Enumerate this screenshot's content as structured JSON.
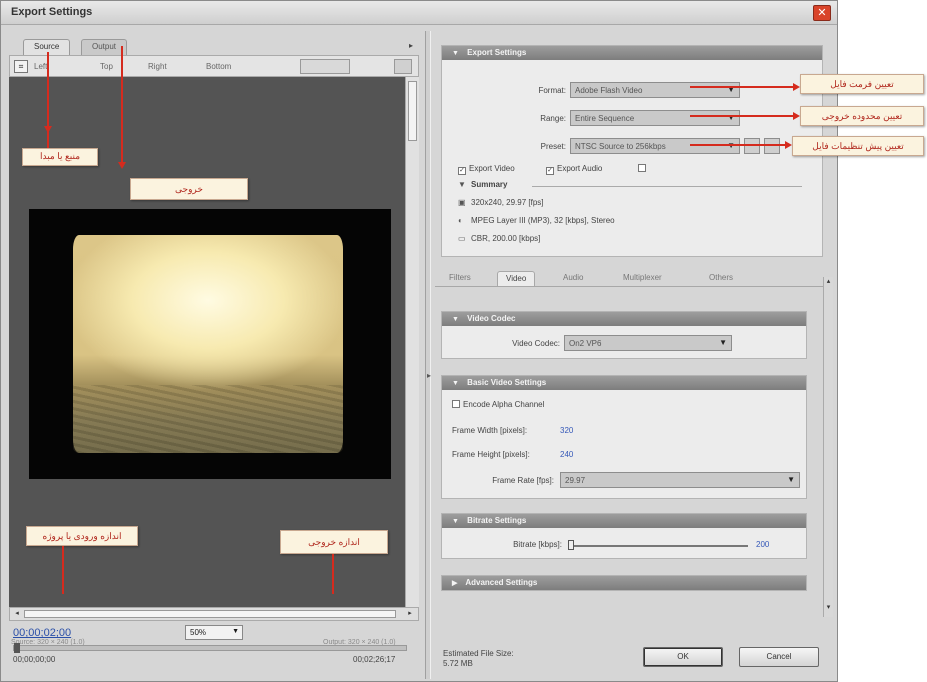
{
  "window": {
    "title": "Export Settings",
    "close_glyph": "✕"
  },
  "left": {
    "tabs": [
      {
        "label": "Source"
      },
      {
        "label": "Output"
      }
    ],
    "crop": {
      "left": "Left",
      "top": "Top",
      "right": "Right",
      "bottom": "Bottom"
    },
    "source_size": "Source: 320 × 240 (1.0)",
    "output_size": "Output: 320 × 240 (1.0)",
    "timecode": "00;00;02;00",
    "zoom": "50%",
    "time_start": "00;00;00;00",
    "time_end": "00;02;26;17"
  },
  "annotations": {
    "source": "منبع یا مبدا",
    "output": "خروجی",
    "project_input_size": "اندازه ورودی یا پروژه",
    "output_size": "اندازه خروجی",
    "file_format": "تعیین فرمت فایل",
    "output_range": "تعیین محدوده خروجی",
    "preset": "تعیین پیش تنظیمات فایل"
  },
  "export_settings": {
    "header": "Export Settings",
    "format_label": "Format:",
    "format_value": "Adobe Flash Video",
    "range_label": "Range:",
    "range_value": "Entire Sequence",
    "preset_label": "Preset:",
    "preset_value": "NTSC Source to 256kbps",
    "export_video": "Export Video",
    "export_audio": "Export Audio",
    "summary_label": "Summary",
    "summary": [
      "320x240, 29.97 [fps]",
      "MPEG Layer III (MP3), 32 [kbps], Stereo",
      "CBR, 200.00 [kbps]"
    ]
  },
  "tabs2": [
    {
      "label": "Filters"
    },
    {
      "label": "Video"
    },
    {
      "label": "Audio"
    },
    {
      "label": "Multiplexer"
    },
    {
      "label": "Others"
    }
  ],
  "video_codec": {
    "header": "Video Codec",
    "label": "Video Codec:",
    "value": "On2 VP6"
  },
  "basic_video": {
    "header": "Basic Video Settings",
    "encode_alpha": "Encode Alpha Channel",
    "frame_width_label": "Frame Width [pixels]:",
    "frame_width": "320",
    "frame_height_label": "Frame Height [pixels]:",
    "frame_height": "240",
    "frame_rate_label": "Frame Rate [fps]:",
    "frame_rate": "29.97"
  },
  "bitrate": {
    "header": "Bitrate Settings",
    "label": "Bitrate [kbps]:",
    "value": "200"
  },
  "advanced": {
    "header": "Advanced Settings"
  },
  "bottom": {
    "estimated_label": "Estimated File Size:",
    "estimated_value": "5.72 MB",
    "ok": "OK",
    "cancel": "Cancel"
  },
  "colors": {
    "annotation_red": "#d52b1e",
    "link_blue": "#2a4fa8",
    "section_header": "#8a8a8a"
  },
  "icons": [
    "close-icon",
    "crop-icon",
    "video-icon",
    "audio-icon",
    "bitrate-icon",
    "collapse-triangle-icon",
    "dropdown-caret-icon",
    "checkbox-icon"
  ]
}
